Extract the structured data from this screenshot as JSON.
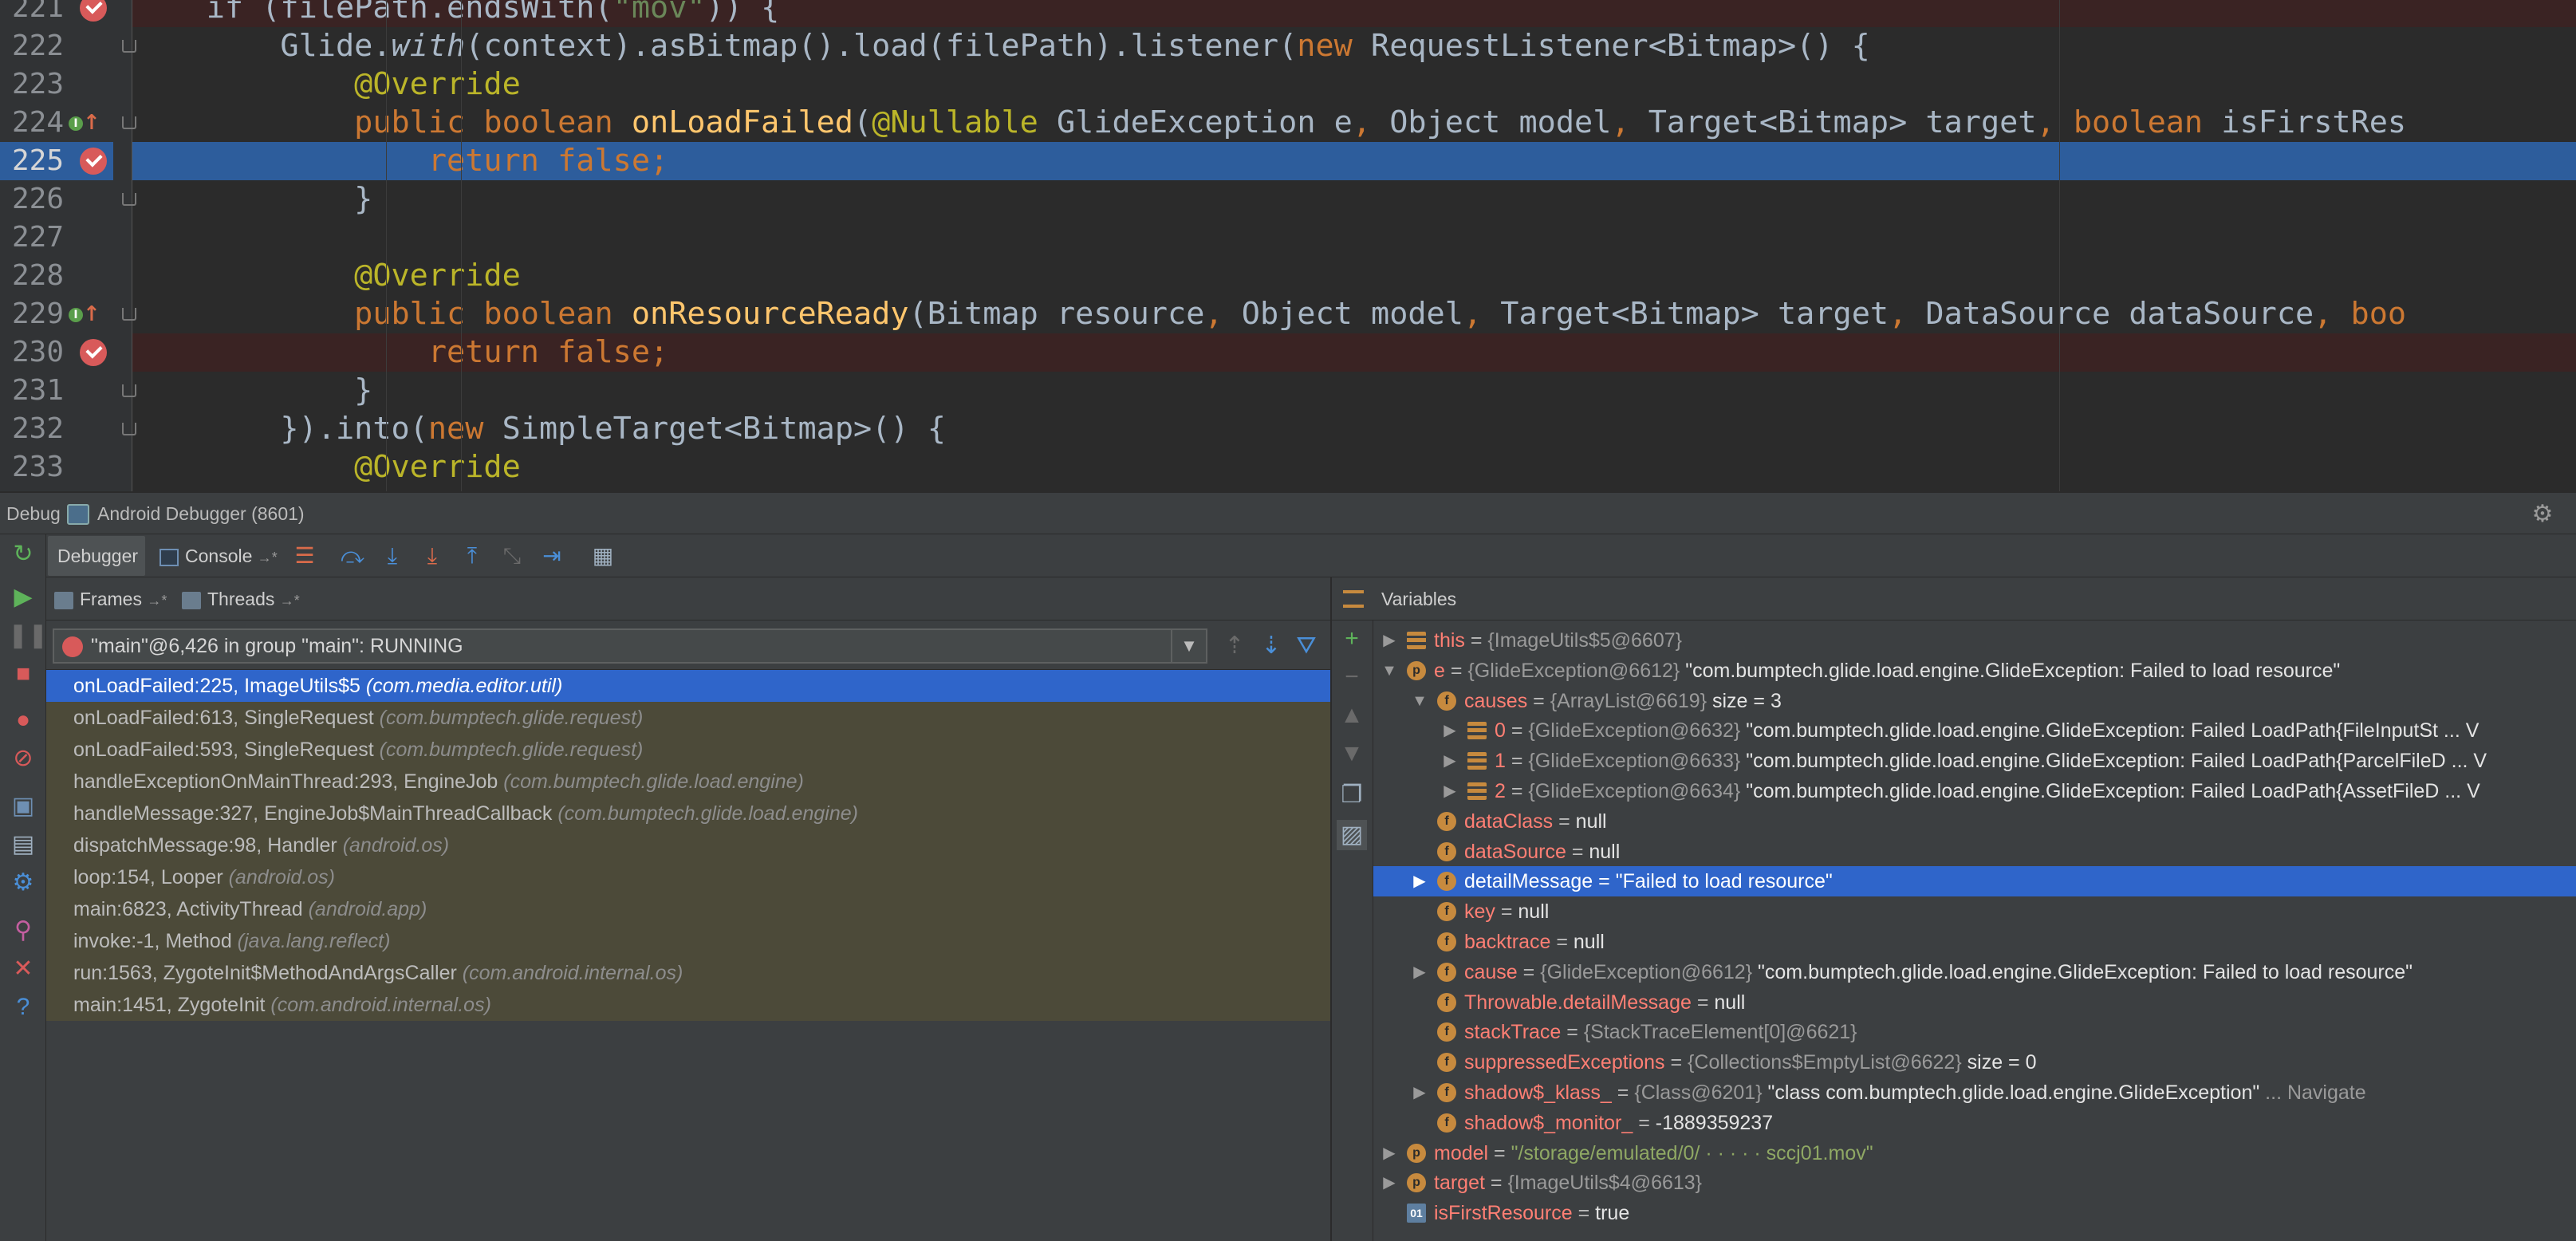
{
  "editor": {
    "line_numbers": [
      "221",
      "222",
      "223",
      "224",
      "225",
      "226",
      "227",
      "228",
      "229",
      "230",
      "231",
      "232",
      "233"
    ],
    "lines": [
      [
        {
          "t": "    if (filePath.endsWith(",
          "c": "plain"
        },
        {
          "t": "\"mov\"",
          "c": "st"
        },
        {
          "t": ")) {",
          "c": "plain"
        }
      ],
      [
        {
          "t": "        Glide.",
          "c": "plain"
        },
        {
          "t": "with",
          "c": "it"
        },
        {
          "t": "(context).asBitmap().load(filePath).listener(",
          "c": "plain"
        },
        {
          "t": "new",
          "c": "kw"
        },
        {
          "t": " RequestListener<Bitmap>() {",
          "c": "plain"
        }
      ],
      [
        {
          "t": "            @Override",
          "c": "an"
        }
      ],
      [
        {
          "t": "            public boolean ",
          "c": "kw"
        },
        {
          "t": "onLoadFailed",
          "c": "fn"
        },
        {
          "t": "(",
          "c": "plain"
        },
        {
          "t": "@Nullable",
          "c": "an"
        },
        {
          "t": " GlideException e",
          "c": "plain"
        },
        {
          "t": ",",
          "c": "kw"
        },
        {
          "t": " Object model",
          "c": "plain"
        },
        {
          "t": ",",
          "c": "kw"
        },
        {
          "t": " Target<Bitmap> target",
          "c": "plain"
        },
        {
          "t": ", boolean",
          "c": "kw"
        },
        {
          "t": " isFirstRes",
          "c": "plain"
        }
      ],
      [
        {
          "t": "                return false;",
          "c": "kw"
        }
      ],
      [
        {
          "t": "            }",
          "c": "plain"
        }
      ],
      [
        {
          "t": "",
          "c": "plain"
        }
      ],
      [
        {
          "t": "            @Override",
          "c": "an"
        }
      ],
      [
        {
          "t": "            public boolean ",
          "c": "kw"
        },
        {
          "t": "onResourceReady",
          "c": "fn"
        },
        {
          "t": "(Bitmap resource",
          "c": "plain"
        },
        {
          "t": ",",
          "c": "kw"
        },
        {
          "t": " Object model",
          "c": "plain"
        },
        {
          "t": ",",
          "c": "kw"
        },
        {
          "t": " Target<Bitmap> target",
          "c": "plain"
        },
        {
          "t": ",",
          "c": "kw"
        },
        {
          "t": " DataSource dataSource",
          "c": "plain"
        },
        {
          "t": ", boo",
          "c": "kw"
        }
      ],
      [
        {
          "t": "                return false;",
          "c": "kw"
        }
      ],
      [
        {
          "t": "            }",
          "c": "plain"
        }
      ],
      [
        {
          "t": "        }).into(",
          "c": "plain"
        },
        {
          "t": "new",
          "c": "kw"
        },
        {
          "t": " SimpleTarget<Bitmap>() {",
          "c": "plain"
        }
      ],
      [
        {
          "t": "            @Override",
          "c": "an"
        }
      ]
    ],
    "breakpoint_lines": [
      "221",
      "225",
      "230"
    ],
    "current_line": "225"
  },
  "debug_window": {
    "label": "Debug",
    "title": "Android Debugger (8601)",
    "gear_icon": "gear-icon"
  },
  "toolbar": {
    "debugger_tab": "Debugger",
    "console_tab": "Console",
    "console_suffix": "→*"
  },
  "frames_panel": {
    "frames_tab": "Frames",
    "threads_tab": "Threads",
    "tab_suffix": "→*",
    "thread_selector": "\"main\"@6,426 in group \"main\": RUNNING",
    "frames": [
      {
        "method": "onLoadFailed:225, ImageUtils$5 ",
        "pkg": "(com.media.editor.util)"
      },
      {
        "method": "onLoadFailed:613, SingleRequest ",
        "pkg": "(com.bumptech.glide.request)"
      },
      {
        "method": "onLoadFailed:593, SingleRequest ",
        "pkg": "(com.bumptech.glide.request)"
      },
      {
        "method": "handleExceptionOnMainThread:293, EngineJob ",
        "pkg": "(com.bumptech.glide.load.engine)"
      },
      {
        "method": "handleMessage:327, EngineJob$MainThreadCallback ",
        "pkg": "(com.bumptech.glide.load.engine)"
      },
      {
        "method": "dispatchMessage:98, Handler ",
        "pkg": "(android.os)"
      },
      {
        "method": "loop:154, Looper ",
        "pkg": "(android.os)"
      },
      {
        "method": "main:6823, ActivityThread ",
        "pkg": "(android.app)"
      },
      {
        "method": "invoke:-1, Method ",
        "pkg": "(java.lang.reflect)"
      },
      {
        "method": "run:1563, ZygoteInit$MethodAndArgsCaller ",
        "pkg": "(com.android.internal.os)"
      },
      {
        "method": "main:1451, ZygoteInit ",
        "pkg": "(com.android.internal.os)"
      }
    ]
  },
  "variables_panel": {
    "title": "Variables",
    "rows": [
      {
        "depth": 0,
        "exp": "▶",
        "icon": "list",
        "name": "this",
        "type": "{ImageUtils$5@6607}",
        "val": ""
      },
      {
        "depth": 0,
        "exp": "▼",
        "icon": "p",
        "name": "e",
        "type": "{GlideException@6612}",
        "val": "\"com.bumptech.glide.load.engine.GlideException: Failed to load resource\""
      },
      {
        "depth": 1,
        "exp": "▼",
        "icon": "f",
        "name": "causes",
        "type": "{ArrayList@6619}",
        "val": " size = 3"
      },
      {
        "depth": 2,
        "exp": "▶",
        "icon": "list",
        "name": "0",
        "type": "{GlideException@6632}",
        "val": "\"com.bumptech.glide.load.engine.GlideException: Failed LoadPath{FileInputSt ... V"
      },
      {
        "depth": 2,
        "exp": "▶",
        "icon": "list",
        "name": "1",
        "type": "{GlideException@6633}",
        "val": "\"com.bumptech.glide.load.engine.GlideException: Failed LoadPath{ParcelFileD ... V"
      },
      {
        "depth": 2,
        "exp": "▶",
        "icon": "list",
        "name": "2",
        "type": "{GlideException@6634}",
        "val": "\"com.bumptech.glide.load.engine.GlideException: Failed LoadPath{AssetFileD ... V"
      },
      {
        "depth": 1,
        "exp": "",
        "icon": "f",
        "name": "dataClass",
        "type": "",
        "val": "null"
      },
      {
        "depth": 1,
        "exp": "",
        "icon": "f",
        "name": "dataSource",
        "type": "",
        "val": "null"
      },
      {
        "depth": 1,
        "exp": "▶",
        "icon": "f",
        "name": "detailMessage",
        "type": "",
        "val": "\"Failed to load resource\"",
        "selected": true
      },
      {
        "depth": 1,
        "exp": "",
        "icon": "f",
        "name": "key",
        "type": "",
        "val": "null"
      },
      {
        "depth": 1,
        "exp": "",
        "icon": "f",
        "name": "backtrace",
        "type": "",
        "val": "null"
      },
      {
        "depth": 1,
        "exp": "▶",
        "icon": "f",
        "name": "cause",
        "type": "{GlideException@6612}",
        "val": "\"com.bumptech.glide.load.engine.GlideException: Failed to load resource\""
      },
      {
        "depth": 1,
        "exp": "",
        "icon": "f",
        "name": "Throwable.detailMessage",
        "type": "",
        "val": "null"
      },
      {
        "depth": 1,
        "exp": "",
        "icon": "f",
        "name": "stackTrace",
        "type": "{StackTraceElement[0]@6621}",
        "val": ""
      },
      {
        "depth": 1,
        "exp": "",
        "icon": "f",
        "name": "suppressedExceptions",
        "type": "{Collections$EmptyList@6622}",
        "val": " size = 0"
      },
      {
        "depth": 1,
        "exp": "▶",
        "icon": "f",
        "name": "shadow$_klass_",
        "type": "{Class@6201}",
        "val": "\"class com.bumptech.glide.load.engine.GlideException\"",
        "link": " ... Navigate"
      },
      {
        "depth": 1,
        "exp": "",
        "icon": "f",
        "name": "shadow$_monitor_",
        "type": "",
        "val": "-1889359237"
      },
      {
        "depth": 0,
        "exp": "▶",
        "icon": "p",
        "name": "model",
        "type": "",
        "val": "\"/storage/emulated/0/ · · · · · sccj01.mov\"",
        "strval": true
      },
      {
        "depth": 0,
        "exp": "▶",
        "icon": "p",
        "name": "target",
        "type": "{ImageUtils$4@6613}",
        "val": ""
      },
      {
        "depth": 0,
        "exp": "",
        "icon": "bool",
        "name": "isFirstResource",
        "type": "",
        "val": "true"
      }
    ]
  },
  "colors": {
    "editor_bg": "#2b2b2b",
    "panel_bg": "#3c3f41",
    "selection": "#2f65ca",
    "frame_row_bg": "#4c4a39",
    "breakpoint": "#d85a5a"
  }
}
